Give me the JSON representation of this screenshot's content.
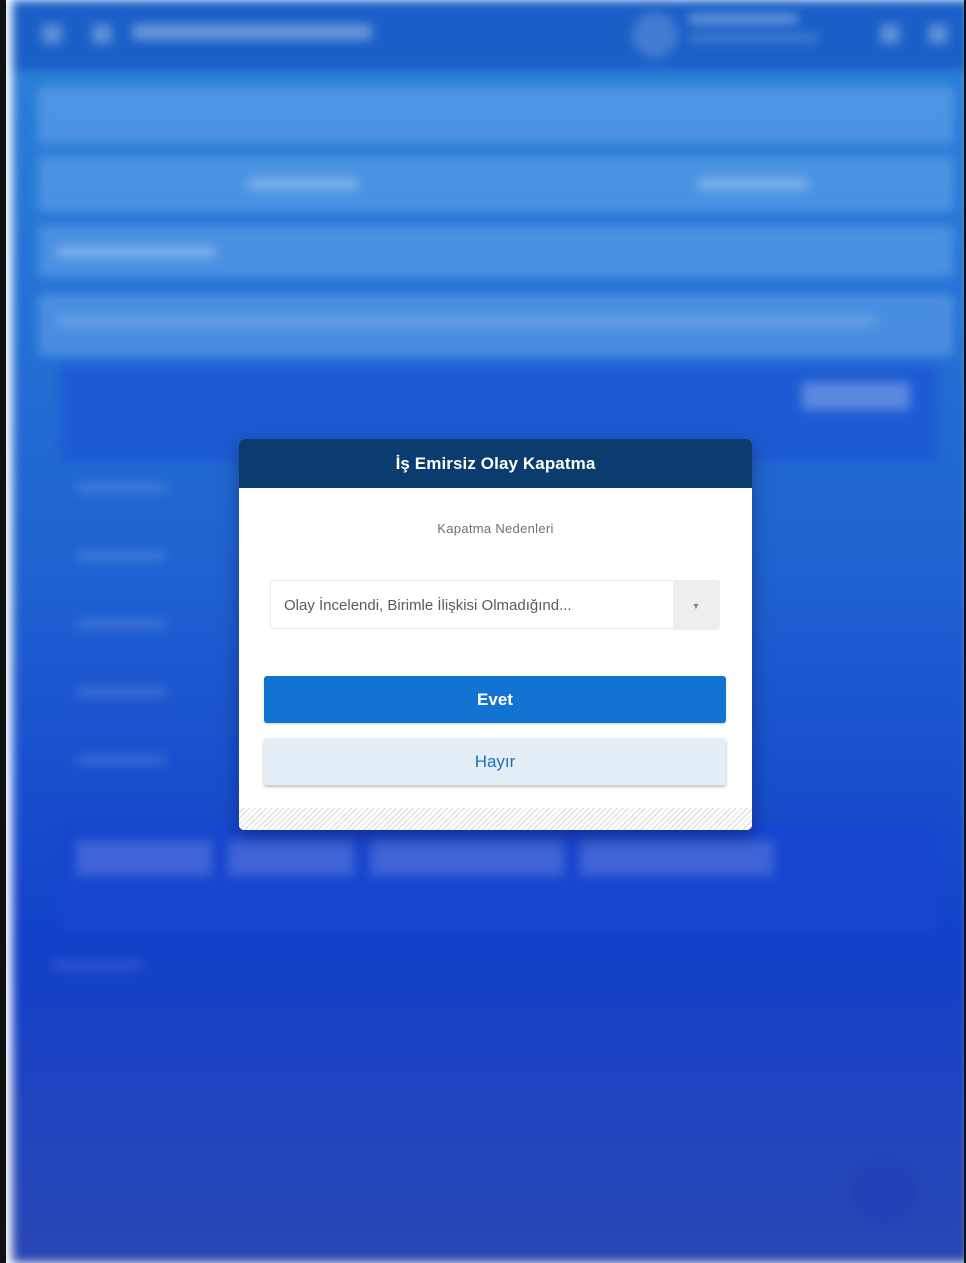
{
  "dialog": {
    "title": "İş Emirsiz Olay Kapatma",
    "subtitle": "Kapatma Nedenleri",
    "select": {
      "value": "Olay İncelendi, Birimle İlişkisi Olmadığınd...",
      "arrow_icon": "caret-down-icon"
    },
    "confirm_label": "Evet",
    "cancel_label": "Hayır"
  },
  "colors": {
    "header": "#0a3c6e",
    "primary": "#1274d2",
    "secondary_bg": "#e3eef7",
    "secondary_text": "#1f6fbf",
    "backdrop": "#1f62d1"
  }
}
